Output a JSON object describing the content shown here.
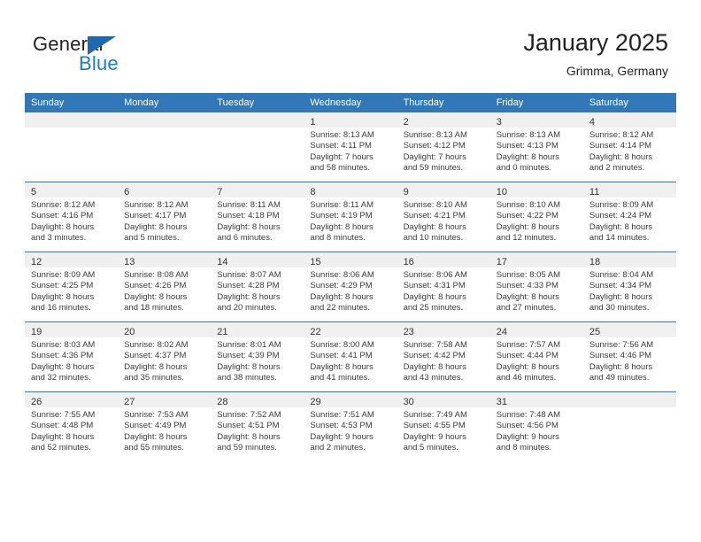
{
  "branding": {
    "logo_primary": "General",
    "logo_secondary": "Blue",
    "triangle_icon": "triangle-icon"
  },
  "header": {
    "title": "January 2025",
    "subtitle": "Grimma, Germany"
  },
  "colors": {
    "header_blue": "#3277b8",
    "logo_blue": "#1b7ec4",
    "daynum_band": "#f0f0f0"
  },
  "calendar": {
    "weekday_headers": [
      "Sunday",
      "Monday",
      "Tuesday",
      "Wednesday",
      "Thursday",
      "Friday",
      "Saturday"
    ],
    "weeks": [
      [
        {
          "day": "",
          "sunrise": "",
          "sunset": "",
          "daylight_line1": "",
          "daylight_line2": ""
        },
        {
          "day": "",
          "sunrise": "",
          "sunset": "",
          "daylight_line1": "",
          "daylight_line2": ""
        },
        {
          "day": "",
          "sunrise": "",
          "sunset": "",
          "daylight_line1": "",
          "daylight_line2": ""
        },
        {
          "day": "1",
          "sunrise": "Sunrise: 8:13 AM",
          "sunset": "Sunset: 4:11 PM",
          "daylight_line1": "Daylight: 7 hours",
          "daylight_line2": "and 58 minutes."
        },
        {
          "day": "2",
          "sunrise": "Sunrise: 8:13 AM",
          "sunset": "Sunset: 4:12 PM",
          "daylight_line1": "Daylight: 7 hours",
          "daylight_line2": "and 59 minutes."
        },
        {
          "day": "3",
          "sunrise": "Sunrise: 8:13 AM",
          "sunset": "Sunset: 4:13 PM",
          "daylight_line1": "Daylight: 8 hours",
          "daylight_line2": "and 0 minutes."
        },
        {
          "day": "4",
          "sunrise": "Sunrise: 8:12 AM",
          "sunset": "Sunset: 4:14 PM",
          "daylight_line1": "Daylight: 8 hours",
          "daylight_line2": "and 2 minutes."
        }
      ],
      [
        {
          "day": "5",
          "sunrise": "Sunrise: 8:12 AM",
          "sunset": "Sunset: 4:16 PM",
          "daylight_line1": "Daylight: 8 hours",
          "daylight_line2": "and 3 minutes."
        },
        {
          "day": "6",
          "sunrise": "Sunrise: 8:12 AM",
          "sunset": "Sunset: 4:17 PM",
          "daylight_line1": "Daylight: 8 hours",
          "daylight_line2": "and 5 minutes."
        },
        {
          "day": "7",
          "sunrise": "Sunrise: 8:11 AM",
          "sunset": "Sunset: 4:18 PM",
          "daylight_line1": "Daylight: 8 hours",
          "daylight_line2": "and 6 minutes."
        },
        {
          "day": "8",
          "sunrise": "Sunrise: 8:11 AM",
          "sunset": "Sunset: 4:19 PM",
          "daylight_line1": "Daylight: 8 hours",
          "daylight_line2": "and 8 minutes."
        },
        {
          "day": "9",
          "sunrise": "Sunrise: 8:10 AM",
          "sunset": "Sunset: 4:21 PM",
          "daylight_line1": "Daylight: 8 hours",
          "daylight_line2": "and 10 minutes."
        },
        {
          "day": "10",
          "sunrise": "Sunrise: 8:10 AM",
          "sunset": "Sunset: 4:22 PM",
          "daylight_line1": "Daylight: 8 hours",
          "daylight_line2": "and 12 minutes."
        },
        {
          "day": "11",
          "sunrise": "Sunrise: 8:09 AM",
          "sunset": "Sunset: 4:24 PM",
          "daylight_line1": "Daylight: 8 hours",
          "daylight_line2": "and 14 minutes."
        }
      ],
      [
        {
          "day": "12",
          "sunrise": "Sunrise: 8:09 AM",
          "sunset": "Sunset: 4:25 PM",
          "daylight_line1": "Daylight: 8 hours",
          "daylight_line2": "and 16 minutes."
        },
        {
          "day": "13",
          "sunrise": "Sunrise: 8:08 AM",
          "sunset": "Sunset: 4:26 PM",
          "daylight_line1": "Daylight: 8 hours",
          "daylight_line2": "and 18 minutes."
        },
        {
          "day": "14",
          "sunrise": "Sunrise: 8:07 AM",
          "sunset": "Sunset: 4:28 PM",
          "daylight_line1": "Daylight: 8 hours",
          "daylight_line2": "and 20 minutes."
        },
        {
          "day": "15",
          "sunrise": "Sunrise: 8:06 AM",
          "sunset": "Sunset: 4:29 PM",
          "daylight_line1": "Daylight: 8 hours",
          "daylight_line2": "and 22 minutes."
        },
        {
          "day": "16",
          "sunrise": "Sunrise: 8:06 AM",
          "sunset": "Sunset: 4:31 PM",
          "daylight_line1": "Daylight: 8 hours",
          "daylight_line2": "and 25 minutes."
        },
        {
          "day": "17",
          "sunrise": "Sunrise: 8:05 AM",
          "sunset": "Sunset: 4:33 PM",
          "daylight_line1": "Daylight: 8 hours",
          "daylight_line2": "and 27 minutes."
        },
        {
          "day": "18",
          "sunrise": "Sunrise: 8:04 AM",
          "sunset": "Sunset: 4:34 PM",
          "daylight_line1": "Daylight: 8 hours",
          "daylight_line2": "and 30 minutes."
        }
      ],
      [
        {
          "day": "19",
          "sunrise": "Sunrise: 8:03 AM",
          "sunset": "Sunset: 4:36 PM",
          "daylight_line1": "Daylight: 8 hours",
          "daylight_line2": "and 32 minutes."
        },
        {
          "day": "20",
          "sunrise": "Sunrise: 8:02 AM",
          "sunset": "Sunset: 4:37 PM",
          "daylight_line1": "Daylight: 8 hours",
          "daylight_line2": "and 35 minutes."
        },
        {
          "day": "21",
          "sunrise": "Sunrise: 8:01 AM",
          "sunset": "Sunset: 4:39 PM",
          "daylight_line1": "Daylight: 8 hours",
          "daylight_line2": "and 38 minutes."
        },
        {
          "day": "22",
          "sunrise": "Sunrise: 8:00 AM",
          "sunset": "Sunset: 4:41 PM",
          "daylight_line1": "Daylight: 8 hours",
          "daylight_line2": "and 41 minutes."
        },
        {
          "day": "23",
          "sunrise": "Sunrise: 7:58 AM",
          "sunset": "Sunset: 4:42 PM",
          "daylight_line1": "Daylight: 8 hours",
          "daylight_line2": "and 43 minutes."
        },
        {
          "day": "24",
          "sunrise": "Sunrise: 7:57 AM",
          "sunset": "Sunset: 4:44 PM",
          "daylight_line1": "Daylight: 8 hours",
          "daylight_line2": "and 46 minutes."
        },
        {
          "day": "25",
          "sunrise": "Sunrise: 7:56 AM",
          "sunset": "Sunset: 4:46 PM",
          "daylight_line1": "Daylight: 8 hours",
          "daylight_line2": "and 49 minutes."
        }
      ],
      [
        {
          "day": "26",
          "sunrise": "Sunrise: 7:55 AM",
          "sunset": "Sunset: 4:48 PM",
          "daylight_line1": "Daylight: 8 hours",
          "daylight_line2": "and 52 minutes."
        },
        {
          "day": "27",
          "sunrise": "Sunrise: 7:53 AM",
          "sunset": "Sunset: 4:49 PM",
          "daylight_line1": "Daylight: 8 hours",
          "daylight_line2": "and 55 minutes."
        },
        {
          "day": "28",
          "sunrise": "Sunrise: 7:52 AM",
          "sunset": "Sunset: 4:51 PM",
          "daylight_line1": "Daylight: 8 hours",
          "daylight_line2": "and 59 minutes."
        },
        {
          "day": "29",
          "sunrise": "Sunrise: 7:51 AM",
          "sunset": "Sunset: 4:53 PM",
          "daylight_line1": "Daylight: 9 hours",
          "daylight_line2": "and 2 minutes."
        },
        {
          "day": "30",
          "sunrise": "Sunrise: 7:49 AM",
          "sunset": "Sunset: 4:55 PM",
          "daylight_line1": "Daylight: 9 hours",
          "daylight_line2": "and 5 minutes."
        },
        {
          "day": "31",
          "sunrise": "Sunrise: 7:48 AM",
          "sunset": "Sunset: 4:56 PM",
          "daylight_line1": "Daylight: 9 hours",
          "daylight_line2": "and 8 minutes."
        },
        {
          "day": "",
          "sunrise": "",
          "sunset": "",
          "daylight_line1": "",
          "daylight_line2": ""
        }
      ]
    ]
  }
}
